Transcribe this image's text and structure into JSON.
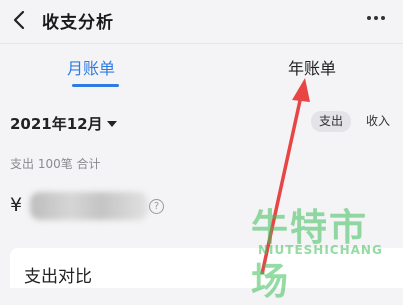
{
  "header": {
    "title": "收支分析",
    "back_icon": "chevron-left-icon",
    "more_icon": "more-horizontal-icon"
  },
  "tabs": [
    {
      "label": "月账单",
      "active": true
    },
    {
      "label": "年账单",
      "active": false
    }
  ],
  "accent_color": "#2f7be4",
  "period": {
    "selected": "2021年12月",
    "dropdown_icon": "caret-down-icon"
  },
  "type_toggle": {
    "expense": "支出",
    "income": "收入",
    "selected": "支出"
  },
  "summary": "支出 100笔 合计",
  "amount": {
    "currency": "¥",
    "help_icon": "question-circle-icon",
    "help_glyph": "?"
  },
  "card": {
    "title": "支出对比"
  },
  "annotation": {
    "arrow_color": "#e84545"
  },
  "watermark": {
    "chinese": "牛特市场",
    "english": "NIUTESHICHANG"
  }
}
